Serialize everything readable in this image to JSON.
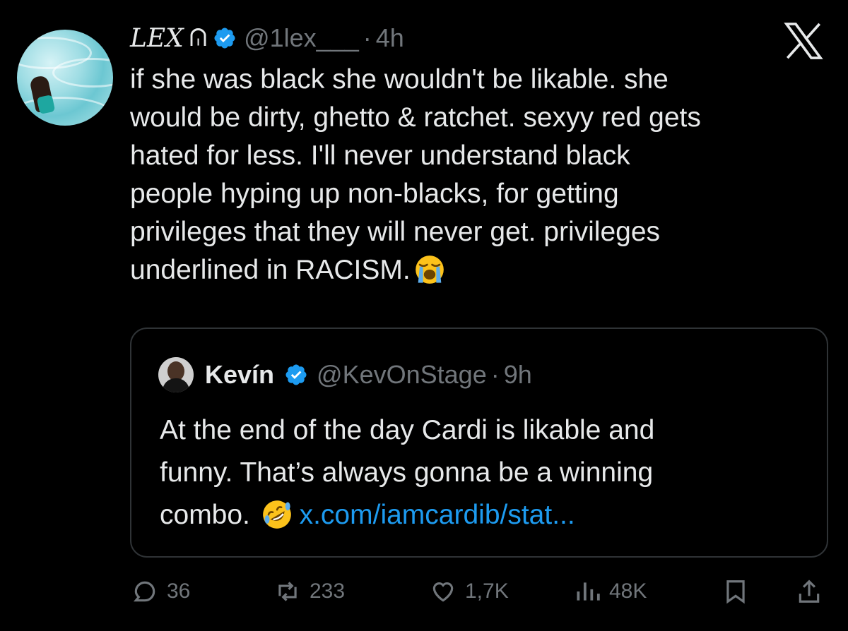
{
  "tweet": {
    "author_name": "LEX",
    "name_glyph": "ᕬ",
    "handle": "@1lex___",
    "separator": "·",
    "time": "4h",
    "text": "if she was black she wouldn't be likable. she\nwould be dirty, ghetto & ratchet. sexyy red gets\nhated for less. I'll never understand black\npeople hyping up non-blacks, for getting\nprivileges that they will never get. privileges\nunderlined in RACISM.",
    "emoji": "loudly-crying-face"
  },
  "quoted": {
    "author_name": "Kevín",
    "handle": "@KevOnStage",
    "separator": "·",
    "time": "9h",
    "text": "At the end of the day Cardi is likable and\nfunny. That’s always gonna be a winning\ncombo.",
    "emoji": "rolling-on-floor-laughing",
    "link": "x.com/iamcardib/stat..."
  },
  "actions": {
    "replies": "36",
    "reposts": "233",
    "likes": "1,7K",
    "views": "48K"
  },
  "colors": {
    "background": "#000000",
    "text": "#e7e9ea",
    "muted": "#71767b",
    "link": "#1d9bf0",
    "verified": "#1d9bf0",
    "border": "#2f3336"
  }
}
